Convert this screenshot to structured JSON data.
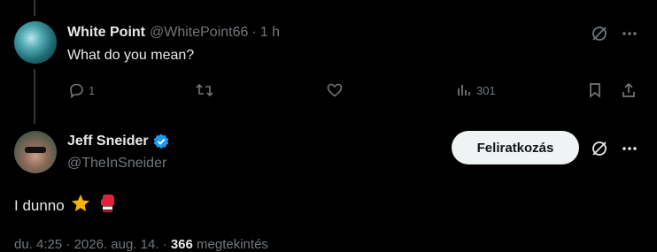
{
  "reply": {
    "display_name": "White Point",
    "handle": "@WhitePoint66",
    "separator": "·",
    "time": "1 h",
    "text": "What do you mean?",
    "replies": "1",
    "views": "301"
  },
  "main_post": {
    "display_name": "Jeff Sneider",
    "handle": "@TheInSneider",
    "follow_label": "Feliratkozás",
    "text": "I dunno",
    "emojis": [
      "star-icon",
      "boxing-glove-icon"
    ]
  },
  "meta": {
    "time": "du. 4:25",
    "sep1": "·",
    "date": "2026. aug. 14.",
    "sep2": "·",
    "views_count": "366",
    "views_label": "megtekintés"
  },
  "colors": {
    "background": "#000000",
    "text": "#e7e9ea",
    "muted": "#71767b",
    "verified": "#1d9bf0",
    "button_bg": "#eff3f4",
    "glove_red": "#d9263b",
    "star_yellow": "#f4b400"
  }
}
